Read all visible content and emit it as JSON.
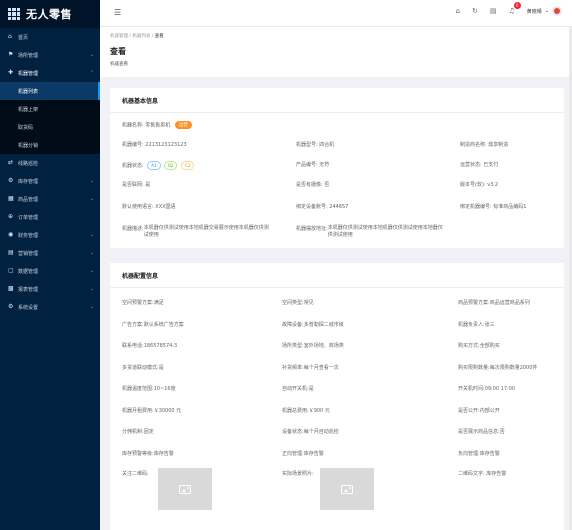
{
  "app": {
    "title": "无人零售"
  },
  "sidebar": {
    "items": [
      {
        "icon": "home-icon",
        "label": "首页"
      },
      {
        "icon": "flag-icon",
        "label": "场所管理"
      },
      {
        "icon": "plus-icon",
        "label": "机器管理",
        "expanded": true,
        "children": [
          "机器列表",
          "机器上架",
          "取货码",
          "机器分销"
        ]
      },
      {
        "icon": "link-icon",
        "label": "线路巡检"
      },
      {
        "icon": "gear-icon",
        "label": "库存管理"
      },
      {
        "icon": "grid-icon",
        "label": "商品管理"
      },
      {
        "icon": "cart-icon",
        "label": "订单管理"
      },
      {
        "icon": "money-icon",
        "label": "财务管理"
      },
      {
        "icon": "chart-icon",
        "label": "营销管理"
      },
      {
        "icon": "doc-icon",
        "label": "数据管理"
      },
      {
        "icon": "grid2-icon",
        "label": "报表管理"
      },
      {
        "icon": "settings-icon",
        "label": "系统设置"
      }
    ],
    "active_child": "机器列表"
  },
  "topbar": {
    "notification_count": "6",
    "user_name": "黄晓晴"
  },
  "breadcrumb": [
    "机器管理",
    "机器列表",
    "查看"
  ],
  "page": {
    "title": "查看",
    "subtitle": "机器查看"
  },
  "basic_info": {
    "title": "机器基本信息",
    "machine_name_label": "机器名称:",
    "machine_name_value": "零售售卖机",
    "machine_name_tag": "运营",
    "fields": [
      {
        "label": "机器编号:",
        "value": "2213123123123"
      },
      {
        "label": "机器型号:",
        "value": "四合机"
      },
      {
        "label": "制造商名称:",
        "value": "鼎享制造"
      },
      {
        "label": "机器状态:",
        "value": ""
      },
      {
        "label": "产品编号:",
        "value": "无符"
      },
      {
        "label": "运营状态:",
        "value": "已支付"
      },
      {
        "label": "是否联网:",
        "value": "是"
      },
      {
        "label": "是否有摄像:",
        "value": "否"
      },
      {
        "label": "版本号(软):",
        "value": "v3.2"
      },
      {
        "label": "默认使用语言:",
        "value": "XXX国语"
      },
      {
        "label": "绑定设备账号:",
        "value": "244657"
      },
      {
        "label": "绑定机器编号:",
        "value": "标准商品编码1"
      },
      {
        "label": "机器描述:",
        "value": "本机器仅供测试使用本地机器交易展示使用本机器仅供测试使用"
      },
      {
        "label": "机器摆放地址:",
        "value": "本机器仅供测试使用本地机器仅供测试使用本地器仅供测试使用"
      }
    ],
    "status_chips": [
      {
        "text": "A1",
        "color": "#1890ff"
      },
      {
        "text": "B2",
        "color": "#52c41a"
      },
      {
        "text": "C3",
        "color": "#fa8c16"
      }
    ]
  },
  "config_info": {
    "title": "机器配置信息",
    "fields": [
      {
        "label": "空间预警方案:",
        "value": "满足"
      },
      {
        "label": "空间类型:",
        "value": "常见"
      },
      {
        "label": "商品预警方案:",
        "value": "商品运营商品系列"
      },
      {
        "label": "广告方案:",
        "value": "默认系统广告方案"
      },
      {
        "label": "故障设备:",
        "value": "多普勒探二城市级"
      },
      {
        "label": "机器负责人:",
        "value": "张三"
      },
      {
        "label": "联系电话:",
        "value": "186578574:3"
      },
      {
        "label": "场所类型:",
        "value": "室外场地、商场类"
      },
      {
        "label": "购买方式:",
        "value": "全部购买"
      },
      {
        "label": "多货道联动模式:",
        "value": "是"
      },
      {
        "label": "补货频率:",
        "value": "每个月查看一次"
      },
      {
        "label": "购买限购数量:",
        "value": "每次限购数量2000件"
      },
      {
        "label": "机器温度范围:",
        "value": "10~16度"
      },
      {
        "label": "自动开关机:",
        "value": "是"
      },
      {
        "label": "开关机时间:",
        "value": "09:00  17:00"
      },
      {
        "label": "机器月租费用:",
        "value": "￥30000 元"
      },
      {
        "label": "机器总费用:",
        "value": "￥900 元"
      },
      {
        "label": "是否公开:",
        "value": "内部公开"
      },
      {
        "label": "分佣机制:",
        "value": "固定"
      },
      {
        "label": "设备状态:",
        "value": "每个月自动巡检"
      },
      {
        "label": "是否展示商品信息:",
        "value": "否"
      },
      {
        "label": "库存预警等级:",
        "value": "库存告警"
      },
      {
        "label": "正向管理:",
        "value": "库存告警"
      },
      {
        "label": "负向管理:",
        "value": "库存告警"
      }
    ],
    "images": [
      {
        "label": "关注二维码:"
      },
      {
        "label": "实际场景照片:"
      }
    ],
    "qr_text_label": "二维码文字:",
    "qr_text_value": "库存告警"
  }
}
